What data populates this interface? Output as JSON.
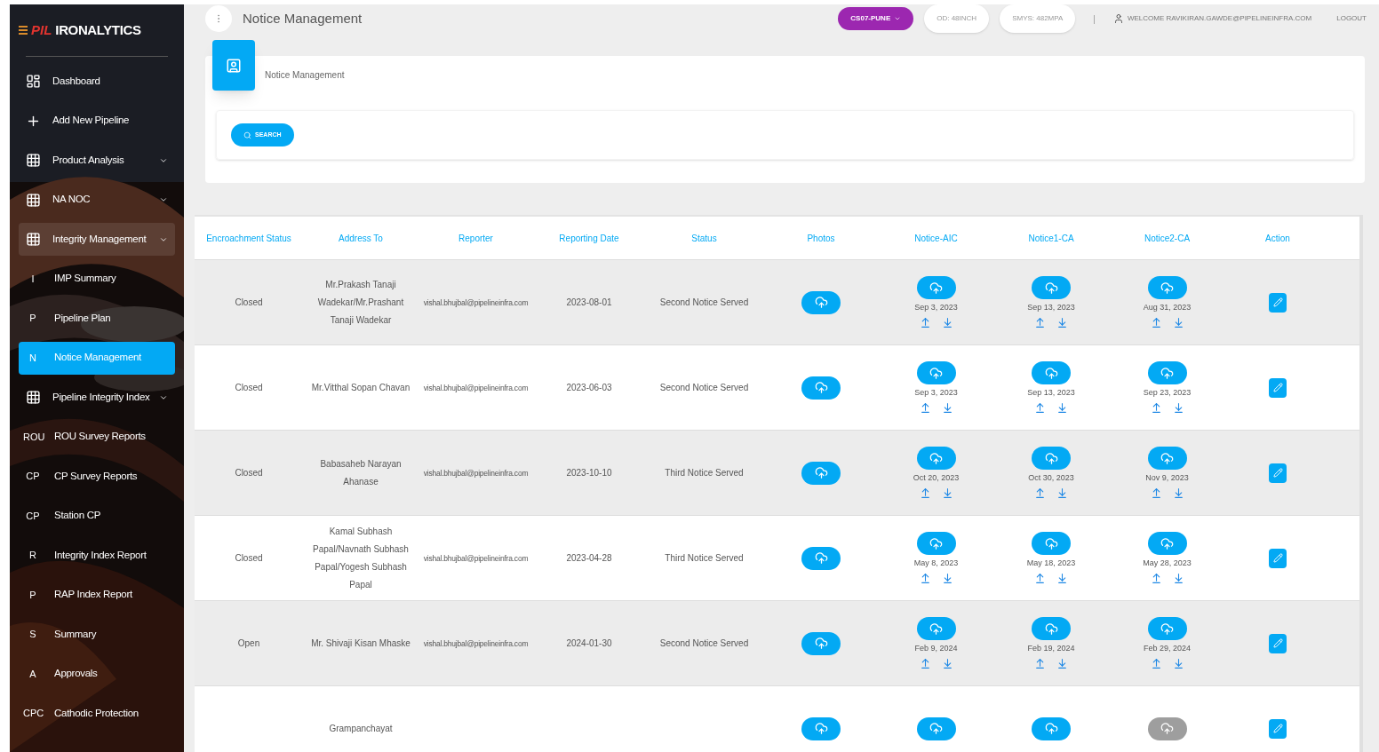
{
  "brand": {
    "mark": "PIL",
    "name": "IRONALYTICS"
  },
  "sidebar": {
    "items": [
      {
        "kind": "dashboard",
        "label": "Dashboard",
        "expandable": false,
        "selected": false
      },
      {
        "kind": "add",
        "label": "Add New Pipeline",
        "expandable": false,
        "selected": false
      },
      {
        "kind": "group",
        "label": "Product Analysis",
        "expandable": true,
        "selected": false
      },
      {
        "kind": "group",
        "label": "NA NOC",
        "expandable": true,
        "selected": false
      },
      {
        "kind": "group",
        "label": "Integrity Management",
        "expandable": true,
        "selected": false,
        "expanded": true
      },
      {
        "kind": "letter",
        "letter": "I",
        "label": "IMP Summary",
        "expandable": false,
        "selected": false
      },
      {
        "kind": "letter",
        "letter": "P",
        "label": "Pipeline Plan",
        "expandable": false,
        "selected": false
      },
      {
        "kind": "letter",
        "letter": "N",
        "label": "Notice Management",
        "expandable": false,
        "selected": true
      },
      {
        "kind": "group",
        "label": "Pipeline Integrity Index",
        "expandable": true,
        "selected": false
      },
      {
        "kind": "letter",
        "letter": "ROU",
        "label": "ROU Survey Reports",
        "expandable": false,
        "selected": false
      },
      {
        "kind": "letter",
        "letter": "CP",
        "label": "CP Survey Reports",
        "expandable": false,
        "selected": false
      },
      {
        "kind": "letter",
        "letter": "CP",
        "label": "Station CP",
        "expandable": false,
        "selected": false
      },
      {
        "kind": "letter",
        "letter": "R",
        "label": "Integrity Index Report",
        "expandable": false,
        "selected": false
      },
      {
        "kind": "letter",
        "letter": "P",
        "label": "RAP Index Report",
        "expandable": false,
        "selected": false
      },
      {
        "kind": "letter",
        "letter": "S",
        "label": "Summary",
        "expandable": false,
        "selected": false
      },
      {
        "kind": "letter",
        "letter": "A",
        "label": "Approvals",
        "expandable": false,
        "selected": false
      },
      {
        "kind": "letter",
        "letter": "CPC",
        "label": "Cathodic Protection",
        "expandable": false,
        "selected": false
      }
    ]
  },
  "topbar": {
    "title": "Notice Management",
    "station": "CS07-PUNE",
    "chips": [
      "OD: 48INCH",
      "SMYS: 482MPA"
    ],
    "separator": "|",
    "welcome": "WELCOME RAVIKIRAN.GAWDE@PIPELINEINFRA.COM",
    "logout": "LOGOUT"
  },
  "card": {
    "title": "Notice Management",
    "search_button": "SEARCH"
  },
  "table": {
    "columns": [
      "Encroachment Status",
      "Address To",
      "Reporter",
      "Reporting Date",
      "Status",
      "Photos",
      "Notice-AIC",
      "Notice1-CA",
      "Notice2-CA",
      "Action"
    ],
    "rows": [
      {
        "encroachment_status": "Closed",
        "address_to": "Mr.Prakash Tanaji Wadekar/Mr.Prashant Tanaji Wadekar",
        "reporter": "vishal.bhujbal@pipelineinfra.com",
        "reporting_date": "2023-08-01",
        "status": "Second Notice Served",
        "notices": [
          {
            "date": "Sep 3, 2023",
            "available": true
          },
          {
            "date": "Sep 13, 2023",
            "available": true
          },
          {
            "date": "Aug 31, 2023",
            "available": true
          }
        ]
      },
      {
        "encroachment_status": "Closed",
        "address_to": "Mr.Vitthal Sopan Chavan",
        "reporter": "vishal.bhujbal@pipelineinfra.com",
        "reporting_date": "2023-06-03",
        "status": "Second Notice Served",
        "notices": [
          {
            "date": "Sep 3, 2023",
            "available": true
          },
          {
            "date": "Sep 13, 2023",
            "available": true
          },
          {
            "date": "Sep 23, 2023",
            "available": true
          }
        ]
      },
      {
        "encroachment_status": "Closed",
        "address_to": "Babasaheb Narayan Ahanase",
        "reporter": "vishal.bhujbal@pipelineinfra.com",
        "reporting_date": "2023-10-10",
        "status": "Third Notice Served",
        "notices": [
          {
            "date": "Oct 20, 2023",
            "available": true
          },
          {
            "date": "Oct 30, 2023",
            "available": true
          },
          {
            "date": "Nov 9, 2023",
            "available": true
          }
        ]
      },
      {
        "encroachment_status": "Closed",
        "address_to": "Kamal Subhash Papal/Navnath Subhash Papal/Yogesh Subhash Papal",
        "reporter": "vishal.bhujbal@pipelineinfra.com",
        "reporting_date": "2023-04-28",
        "status": "Third Notice Served",
        "notices": [
          {
            "date": "May 8, 2023",
            "available": true
          },
          {
            "date": "May 18, 2023",
            "available": true
          },
          {
            "date": "May 28, 2023",
            "available": true
          }
        ]
      },
      {
        "encroachment_status": "Open",
        "address_to": "Mr. Shivaji Kisan Mhaske",
        "reporter": "vishal.bhujbal@pipelineinfra.com",
        "reporting_date": "2024-01-30",
        "status": "Second Notice Served",
        "notices": [
          {
            "date": "Feb 9, 2024",
            "available": true
          },
          {
            "date": "Feb 19, 2024",
            "available": true
          },
          {
            "date": "Feb 29, 2024",
            "available": true
          }
        ]
      },
      {
        "address_to": "Grampanchayat",
        "notices": [
          {
            "available": true
          },
          {
            "available": true
          },
          {
            "available": false
          }
        ]
      }
    ]
  }
}
